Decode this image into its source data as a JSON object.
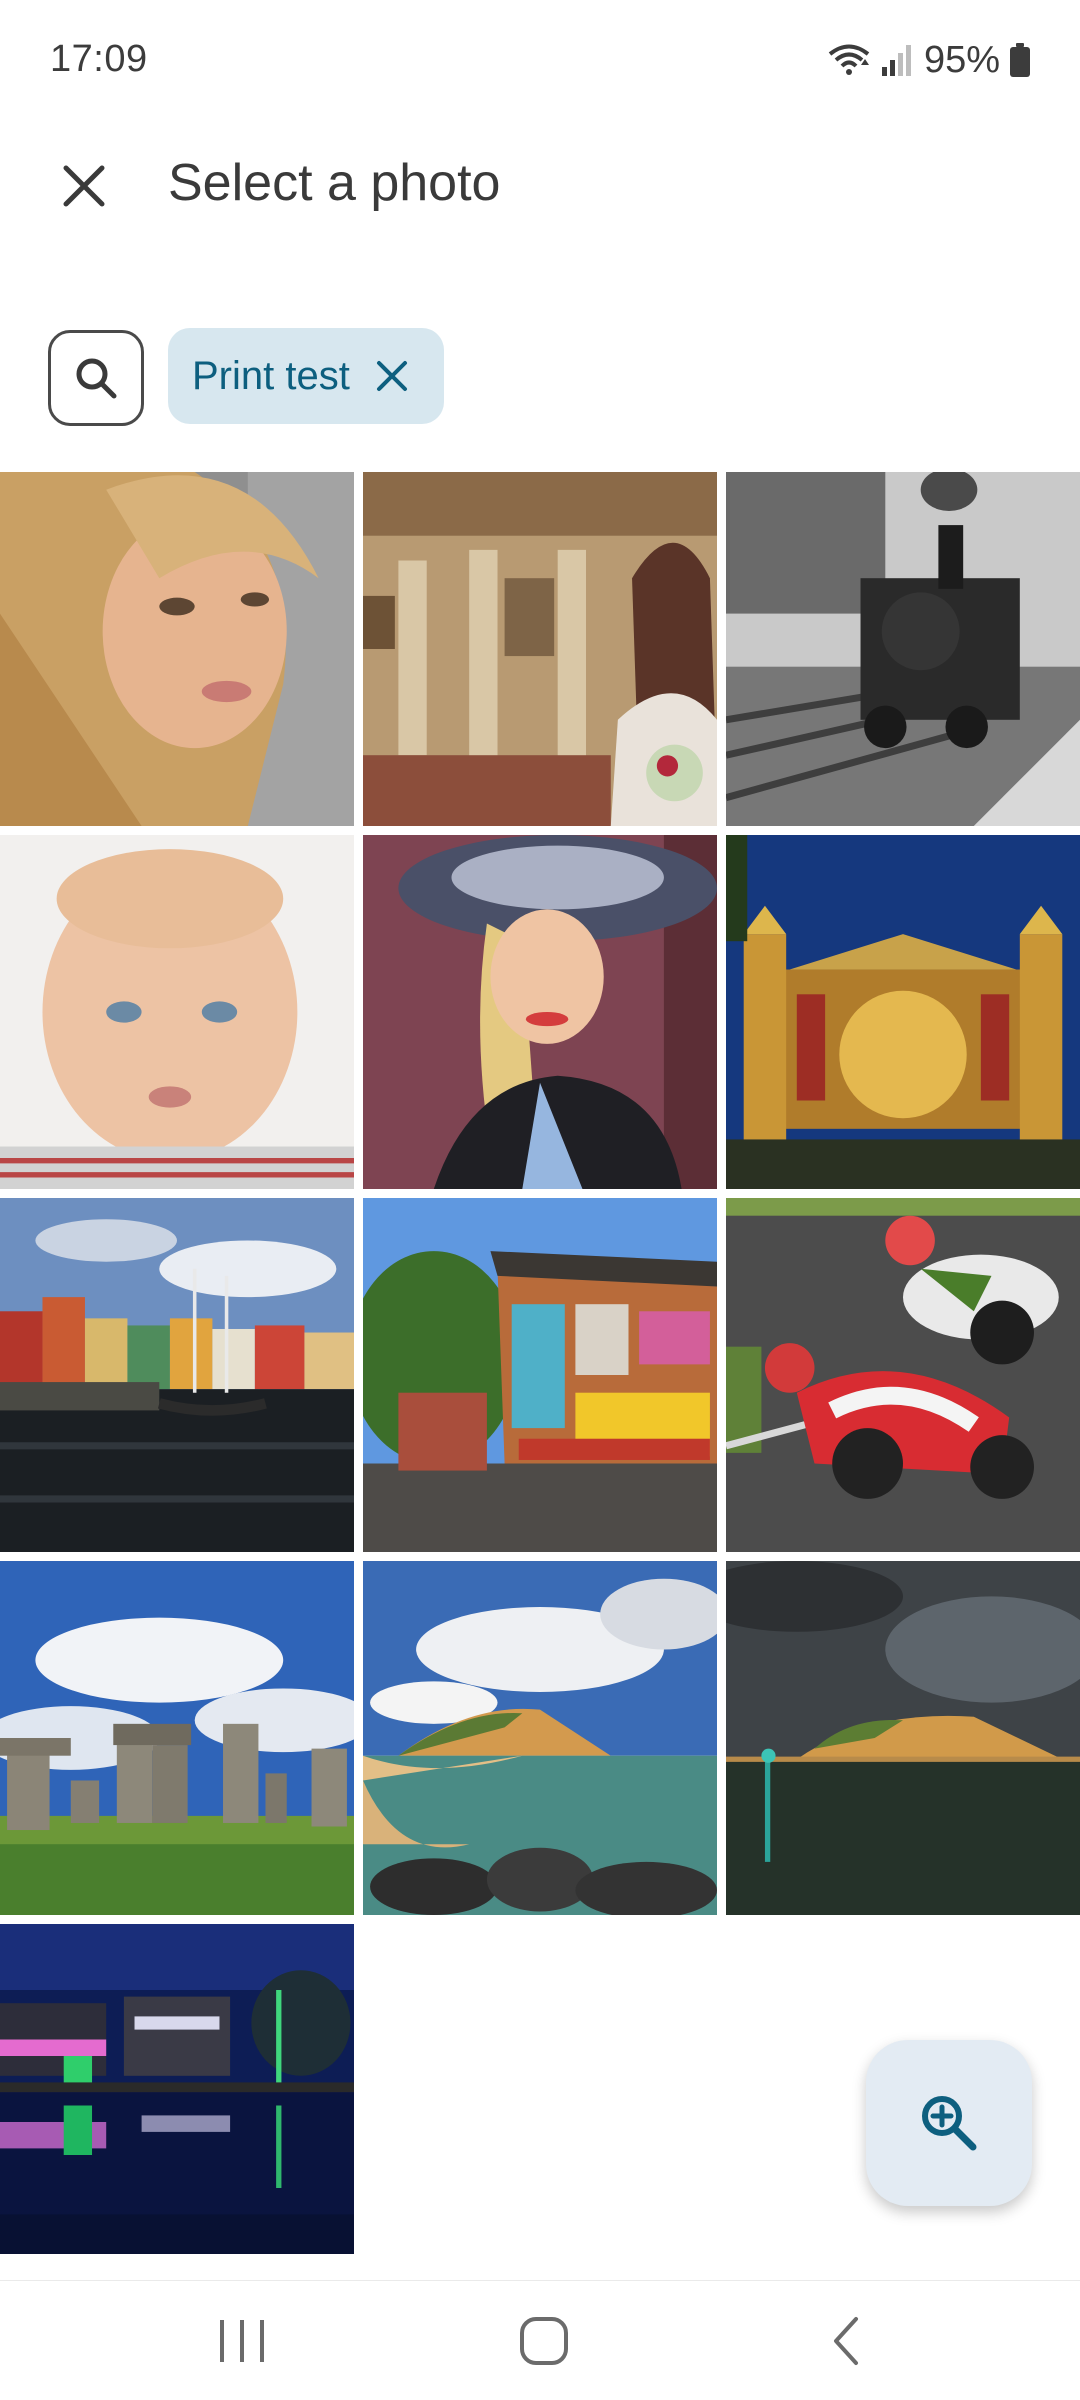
{
  "status": {
    "time": "17:09",
    "battery": "95%",
    "icons": [
      "wifi-icon",
      "signal-icon",
      "battery-icon"
    ]
  },
  "header": {
    "title": "Select a photo",
    "close_icon": "close-icon"
  },
  "search": {
    "icon": "search-icon",
    "chip_label": "Print test",
    "chip_remove_icon": "close-icon"
  },
  "photos": [
    {
      "subject": "woman portrait"
    },
    {
      "subject": "gallery painting with bride"
    },
    {
      "subject": "steam train"
    },
    {
      "subject": "baby portrait"
    },
    {
      "subject": "woman with hat"
    },
    {
      "subject": "oriental theatre at night"
    },
    {
      "subject": "harbour with boats"
    },
    {
      "subject": "graffiti hut"
    },
    {
      "subject": "motorcycle racers"
    },
    {
      "subject": "stone circle"
    },
    {
      "subject": "coastal cliff beach"
    },
    {
      "subject": "cliff under storm clouds"
    },
    {
      "subject": "city at night"
    }
  ],
  "fab": {
    "icon": "zoom-in-icon"
  },
  "navbar": {
    "icons": [
      "recent-apps-icon",
      "home-icon",
      "back-icon"
    ]
  },
  "colors": {
    "chip_bg": "#d7e7ef",
    "chip_text": "#0d5f7f",
    "fab_bg": "#e3ebf3",
    "fab_icon": "#0d5f7f"
  }
}
